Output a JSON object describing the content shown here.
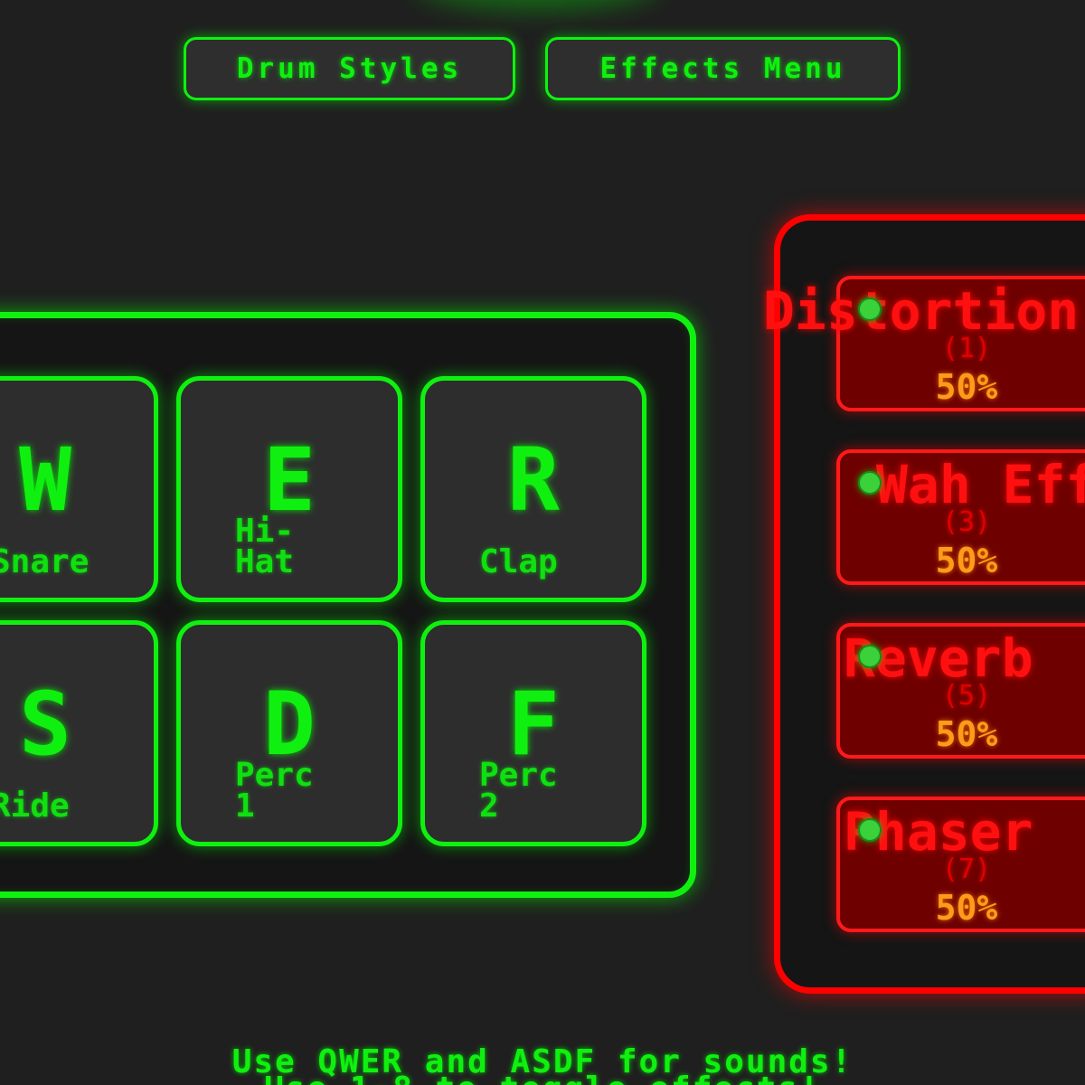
{
  "top_buttons": {
    "drum_styles": "Drum Styles",
    "effects_menu": "Effects Menu"
  },
  "pads": [
    {
      "key": "W",
      "label": "Snare"
    },
    {
      "key": "E",
      "label": "Hi-\nHat"
    },
    {
      "key": "R",
      "label": "Clap"
    },
    {
      "key": "S",
      "label": "Ride"
    },
    {
      "key": "D",
      "label": "Perc\n1"
    },
    {
      "key": "F",
      "label": "Perc\n2"
    }
  ],
  "effects": [
    {
      "name": "Distortion",
      "key": "(1)",
      "level": "50%",
      "active": true
    },
    {
      "name": "Wah Effect",
      "key": "(3)",
      "level": "50%",
      "active": true
    },
    {
      "name": "Reverb",
      "key": "(5)",
      "level": "50%",
      "active": true
    },
    {
      "name": "Phaser",
      "key": "(7)",
      "level": "50%",
      "active": true
    }
  ],
  "footer": {
    "line1": "Use QWER and ASDF for sounds!",
    "line2": "Use 1-8 to toggle effects!"
  },
  "colors": {
    "background": "#1f1f1f",
    "neon_green": "#10f010",
    "neon_red": "#ff1010",
    "effect_fill": "#6e0000",
    "level_orange": "#ff9a1a"
  }
}
